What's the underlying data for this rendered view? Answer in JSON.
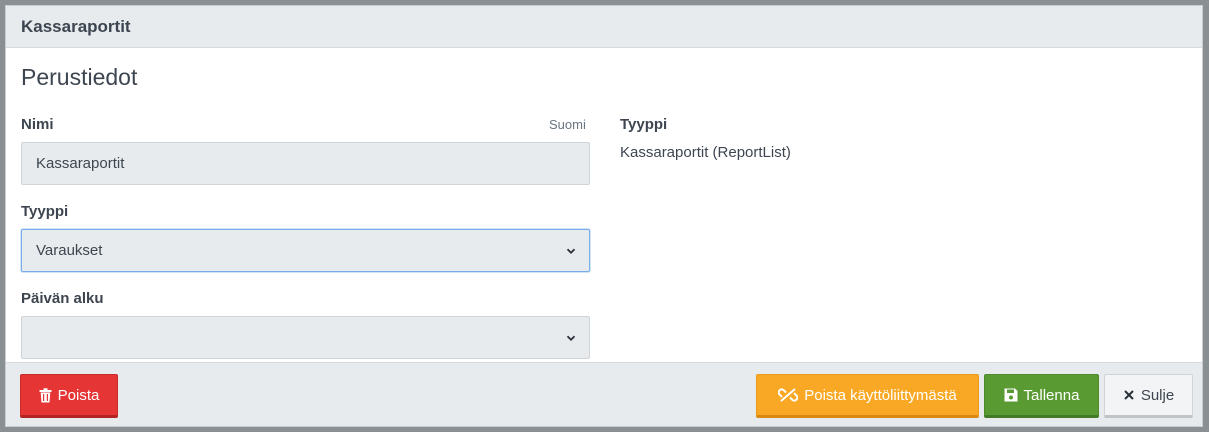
{
  "header": {
    "title": "Kassaraportit"
  },
  "section": {
    "title": "Perustiedot"
  },
  "form": {
    "name_label": "Nimi",
    "name_language": "Suomi",
    "name_value": "Kassaraportit",
    "type_label": "Tyyppi",
    "type_value": "Varaukset",
    "day_start_label": "Päivän alku",
    "day_start_value": ""
  },
  "info": {
    "type_label": "Tyyppi",
    "type_value": "Kassaraportit (ReportList)"
  },
  "footer": {
    "delete_label": "Poista",
    "remove_ui_label": "Poista käyttöliittymästä",
    "save_label": "Tallenna",
    "close_label": "Sulje"
  },
  "colors": {
    "danger": "#e53535",
    "warning": "#f9a825",
    "success": "#5a9a33",
    "focus": "#7aaee8"
  },
  "icons": {
    "delete": "trash-icon",
    "remove_ui": "unlink-icon",
    "save": "floppy-disk-icon",
    "close": "close-icon",
    "select": "chevron-down-icon"
  }
}
